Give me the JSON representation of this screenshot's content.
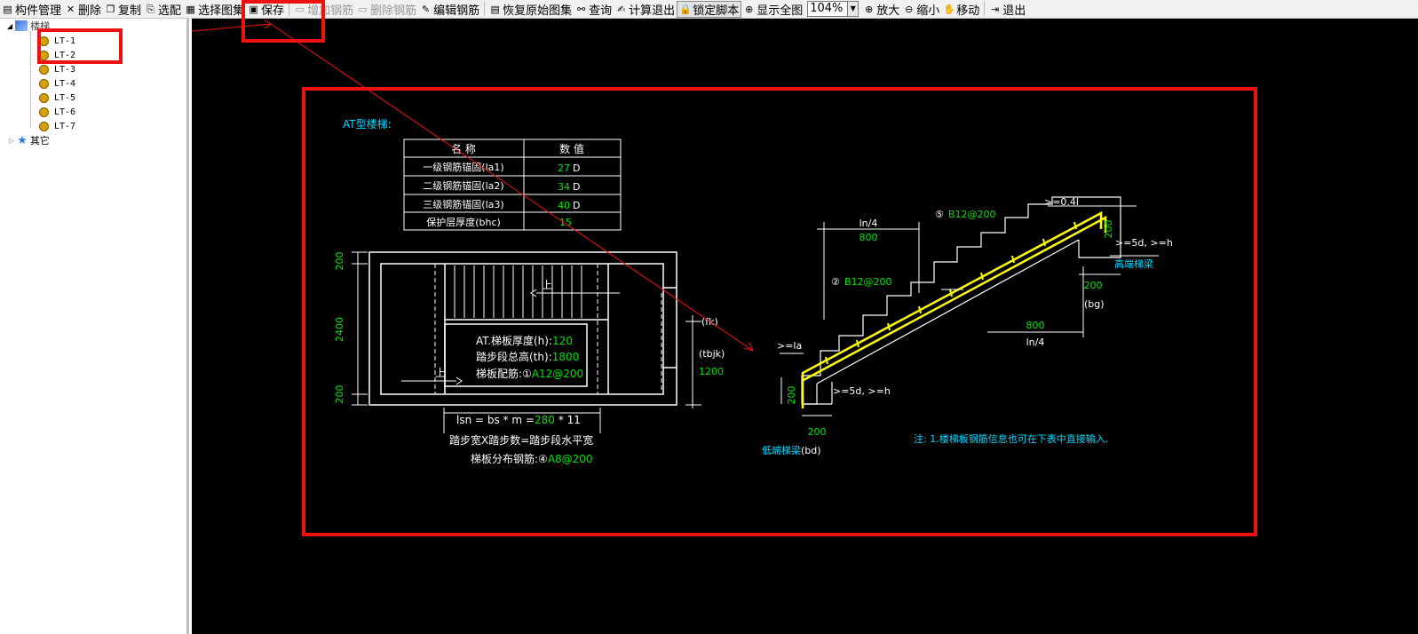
{
  "toolbar": {
    "items": [
      {
        "label": "构件管理",
        "icon": "panel-icon"
      },
      {
        "label": "删除",
        "icon": "x-icon"
      },
      {
        "label": "复制",
        "icon": "copy-icon"
      },
      {
        "label": "选配",
        "icon": "match-icon"
      },
      {
        "label": "选择图集",
        "icon": "atlas-icon"
      },
      {
        "label": "保存",
        "icon": "save-icon"
      },
      {
        "label": "增加钢筋",
        "icon": "add-rebar-icon"
      },
      {
        "label": "删除钢筋",
        "icon": "delete-rebar-icon"
      },
      {
        "label": "编辑钢筋",
        "icon": "edit-rebar-icon"
      },
      {
        "label": "恢复原始图集",
        "icon": "restore-icon"
      },
      {
        "label": "查询",
        "icon": "binoculars-icon"
      },
      {
        "label": "计算退出",
        "icon": "calc-exit-icon"
      },
      {
        "label": "锁定脚本",
        "icon": "lock-icon"
      },
      {
        "label": "显示全图",
        "icon": "fit-icon"
      },
      {
        "label": "放大",
        "icon": "zoom-in-icon"
      },
      {
        "label": "缩小",
        "icon": "zoom-out-icon"
      },
      {
        "label": "移动",
        "icon": "hand-icon"
      },
      {
        "label": "退出",
        "icon": "exit-icon"
      }
    ],
    "zoom_value": "104%"
  },
  "tree": {
    "root": "楼梯",
    "children": [
      "LT-1",
      "LT-2",
      "LT-3",
      "LT-4",
      "LT-5",
      "LT-6",
      "LT-7"
    ],
    "other": "其它"
  },
  "drawing": {
    "title": "AT型楼梯:",
    "table": {
      "headers": [
        "名  称",
        "数  值"
      ],
      "rows": [
        {
          "name": "一级钢筋锚固(la1)",
          "value": "27",
          "unit": "D"
        },
        {
          "name": "二级钢筋锚固(la2)",
          "value": "34",
          "unit": "D"
        },
        {
          "name": "三级钢筋锚固(la3)",
          "value": "40",
          "unit": "D"
        },
        {
          "name": "保护层厚度(bhc)",
          "value": "15",
          "unit": ""
        }
      ]
    },
    "plan": {
      "dim_left_top": "200",
      "dim_left_mid": "2400",
      "dim_left_bot": "200",
      "up1": "上",
      "up2": "上",
      "thickness_label": "AT.梯板厚度(h):",
      "thickness_value": "120",
      "height_label": "踏步段总高(th):",
      "height_value": "1800",
      "rebar_label": "梯板配筋:①",
      "rebar_value": "A12@200",
      "fk": "(fk)",
      "tbjk": "(tbjk)",
      "width_value": "1200",
      "lsn_label": "lsn = bs * m =",
      "lsn_value": "280",
      "lsn_mult": "* 11",
      "step_formula": "踏步宽X踏步数=踏步段水平宽",
      "dist_label": "梯板分布钢筋:④",
      "dist_value": "A8@200"
    },
    "section": {
      "ln4_left": "ln/4",
      "dim800_left": "800",
      "rebar5": "B12@200",
      "circle5": "⑤",
      "rebar2": "B12@200",
      "circle2": "②",
      "ge04": ">=0.4l",
      "ge5d_h_top": ">=5d, >=h",
      "high_beam": "高端梯梁",
      "dim200_top": "200",
      "dim200_right": "200",
      "bg": "(bg)",
      "dim800_right": "800",
      "ln4_right": "ln/4",
      "ge_la": ">=la",
      "dim200_left": "200",
      "ge5d_h_bot": ">=5d, >=h",
      "dim200_bot": "200",
      "low_beam": "低端梯梁",
      "bd": "(bd)"
    },
    "note": "注: 1.楼梯板钢筋信息也可在下表中直接输入."
  },
  "colors": {
    "annotation": "#ee1111",
    "cad_white": "#ffffff",
    "cad_green": "#00e000",
    "cad_cyan": "#00d8ff",
    "cad_yellow": "#ffff00",
    "canvas_bg": "#000000"
  }
}
